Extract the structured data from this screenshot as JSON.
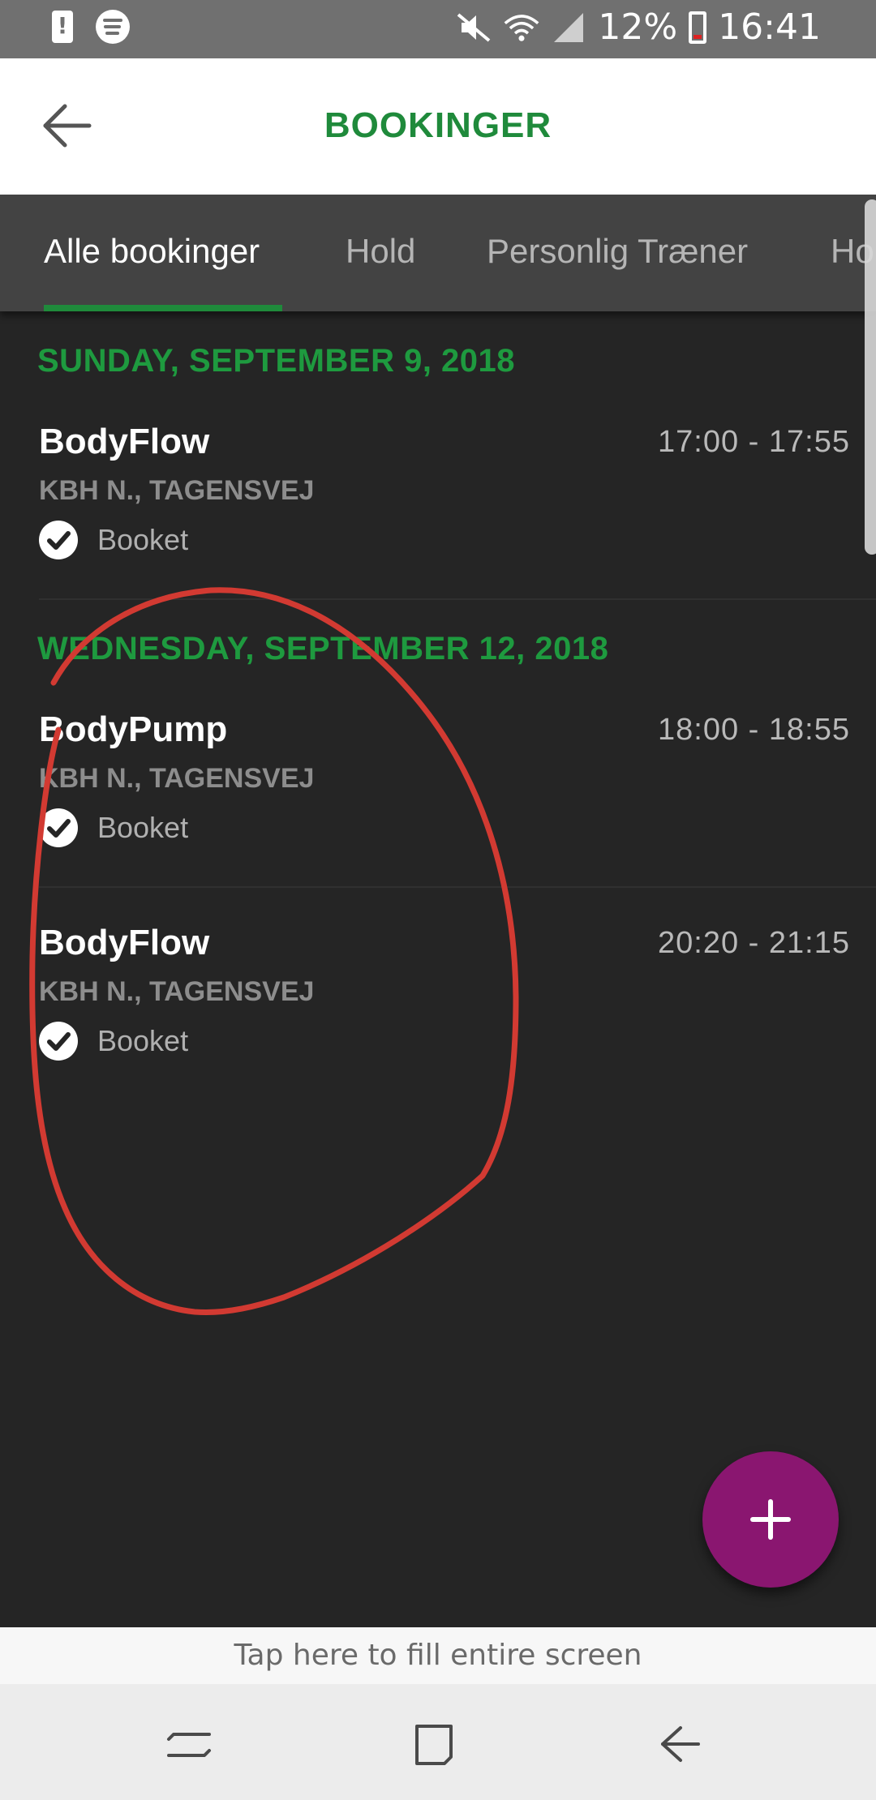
{
  "status_bar": {
    "battery": "12%",
    "time": "16:41",
    "icons": [
      "alert-icon",
      "spotify-icon",
      "mute-icon",
      "wifi-icon",
      "signal-icon",
      "battery-icon"
    ]
  },
  "app_bar": {
    "title": "BOOKINGER",
    "back_icon": "arrow-left-icon",
    "title_color": "#1f8a3b",
    "background": "#ffffff"
  },
  "tabs": [
    {
      "label": "Alle bookinger",
      "active": true
    },
    {
      "label": "Hold",
      "active": false
    },
    {
      "label": "Personlig Træner",
      "active": false
    },
    {
      "label": "Ho",
      "active": false
    }
  ],
  "days": [
    {
      "header": "SUNDAY, SEPTEMBER 9, 2018",
      "bookings": [
        {
          "name": "BodyFlow",
          "time": "17:00 - 17:55",
          "location": "KBH N., TAGENSVEJ",
          "status": "Booket"
        }
      ]
    },
    {
      "header": "WEDNESDAY, SEPTEMBER 12, 2018",
      "bookings": [
        {
          "name": "BodyPump",
          "time": "18:00 - 18:55",
          "location": "KBH N., TAGENSVEJ",
          "status": "Booket"
        },
        {
          "name": "BodyFlow",
          "time": "20:20 - 21:15",
          "location": "KBH N., TAGENSVEJ",
          "status": "Booket"
        }
      ]
    }
  ],
  "fab": {
    "icon": "plus-icon",
    "color": "#8a1670"
  },
  "fill_banner": "Tap here to fill entire screen",
  "nav_bar": {
    "icons": [
      "recent-apps-icon",
      "home-icon",
      "back-icon"
    ]
  },
  "colors": {
    "accent_green": "#1f8a3b",
    "background": "#252525",
    "annotation_red": "#d23a32"
  }
}
